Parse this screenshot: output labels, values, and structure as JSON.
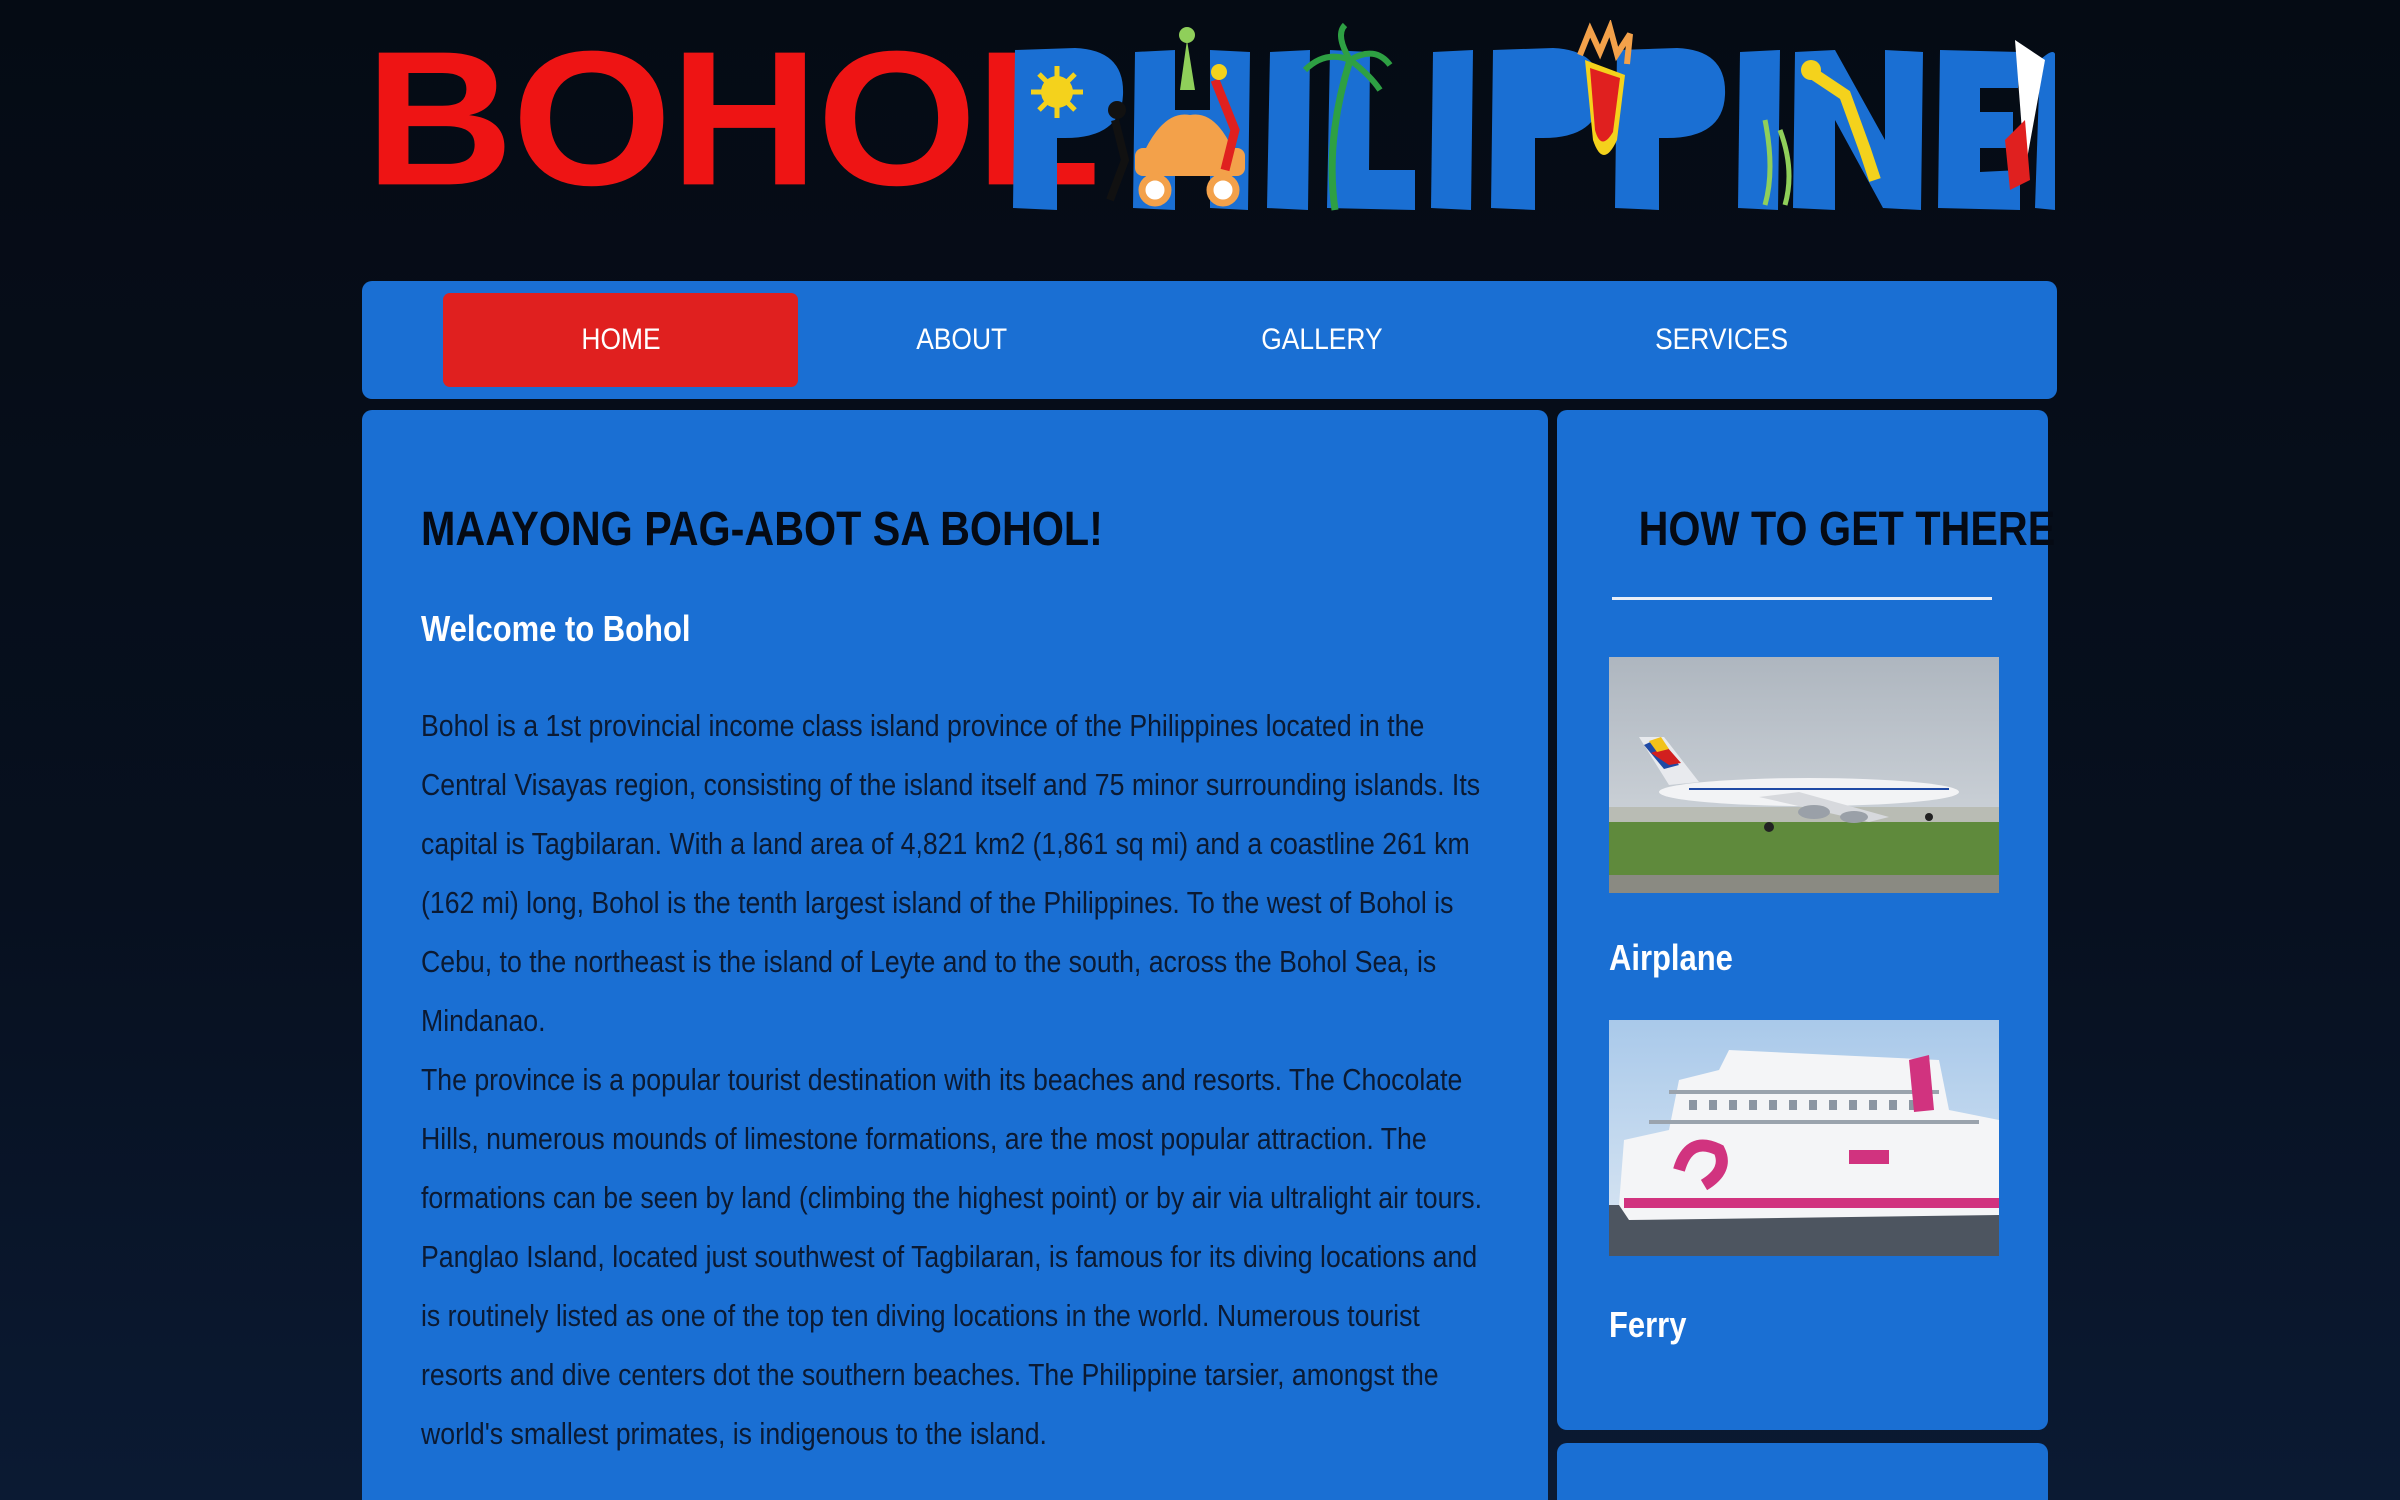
{
  "logo": {
    "word1": "BOHOL",
    "word2": "PHILIPPINES"
  },
  "nav": {
    "items": [
      {
        "label": "HOME",
        "active": true
      },
      {
        "label": "ABOUT"
      },
      {
        "label": "GALLERY"
      },
      {
        "label": "SERVICES"
      }
    ]
  },
  "main": {
    "title": "MAAYONG PAG-ABOT SA BOHOL!",
    "subtitle": "Welcome to Bohol",
    "paragraphs": [
      "Bohol is a 1st provincial income class island province of the Philippines located in the Central Visayas region, consisting of the island itself and 75 minor surrounding islands. Its capital is Tagbilaran. With a land area of 4,821 km2 (1,861 sq mi) and a coastline 261 km (162 mi) long, Bohol is the tenth largest island of the Philippines. To the west of Bohol is Cebu, to the northeast is the island of Leyte and to the south, across the Bohol Sea, is Mindanao.",
      "The province is a popular tourist destination with its beaches and resorts. The Chocolate Hills, numerous mounds of limestone formations, are the most popular attraction. The formations can be seen by land (climbing the highest point) or by air via ultralight air tours. Panglao Island, located just southwest of Tagbilaran, is famous for its diving locations and is routinely listed as one of the top ten diving locations in the world. Numerous tourist resorts and dive centers dot the southern beaches. The Philippine tarsier, amongst the world's smallest primates, is indigenous to the island."
    ]
  },
  "sidebar": {
    "title": "HOW TO GET THERE",
    "items": [
      {
        "caption": "Airplane",
        "icon": "airplane-photo"
      },
      {
        "caption": "Ferry",
        "icon": "ferry-photo"
      }
    ]
  },
  "colors": {
    "background": "#050b14",
    "panel": "#1a6fd3",
    "active_nav": "#e0201f",
    "logo_red": "#ee1414",
    "heading": "#050a14"
  }
}
